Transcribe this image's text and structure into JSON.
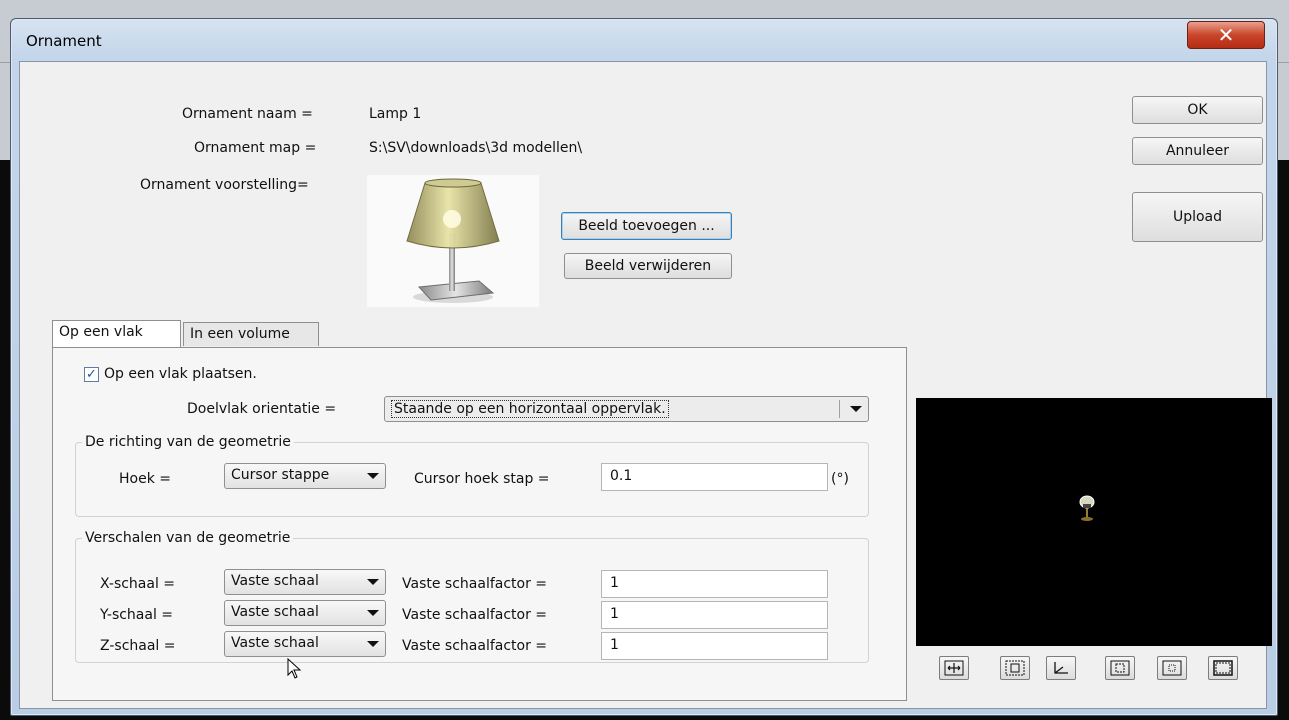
{
  "window": {
    "title": "Ornament",
    "close_glyph": "✕"
  },
  "fields": {
    "name_label": "Ornament naam =",
    "name_value": "Lamp 1",
    "map_label": "Ornament map =",
    "map_value": "S:\\SV\\downloads\\3d modellen\\",
    "image_label": "Ornament voorstelling="
  },
  "buttons": {
    "add_image": "Beeld toevoegen ...",
    "remove_image": "Beeld verwijderen",
    "ok": "OK",
    "cancel": "Annuleer",
    "upload": "Upload"
  },
  "tabs": [
    {
      "label": "Op een vlak",
      "active": true
    },
    {
      "label": "In een volume",
      "active": false
    }
  ],
  "placement": {
    "checkbox_label": "Op een vlak plaatsen.",
    "checked": true,
    "orientation_label": "Doelvlak orientatie =",
    "orientation_value": "Staande op een horizontaal oppervlak."
  },
  "direction_group": {
    "title": "De richting van de geometrie",
    "angle_label": "Hoek =",
    "angle_value": "Cursor stappe",
    "step_label": "Cursor hoek stap =",
    "step_value": "0.1",
    "unit": "(°)"
  },
  "scale_group": {
    "title": "Verschalen van de geometrie",
    "rows": [
      {
        "label": "X-schaal =",
        "mode": "Vaste schaal",
        "factor_label": "Vaste schaalfactor =",
        "factor": "1"
      },
      {
        "label": "Y-schaal =",
        "mode": "Vaste schaal",
        "factor_label": "Vaste schaalfactor =",
        "factor": "1"
      },
      {
        "label": "Z-schaal =",
        "mode": "Vaste schaal",
        "factor_label": "Vaste schaalfactor =",
        "factor": "1"
      }
    ]
  },
  "preview": {
    "view_buttons": [
      "fit-view-icon",
      "zoom-window-icon",
      "axes-icon",
      "zoom-extents-icon",
      "zoom-out-icon",
      "full-frame-icon"
    ]
  },
  "colors": {
    "preview_bg": "#000000",
    "title_bar": "#c3d5ea",
    "close_button": "#c9452b",
    "focus_border": "#3c7fb1"
  }
}
